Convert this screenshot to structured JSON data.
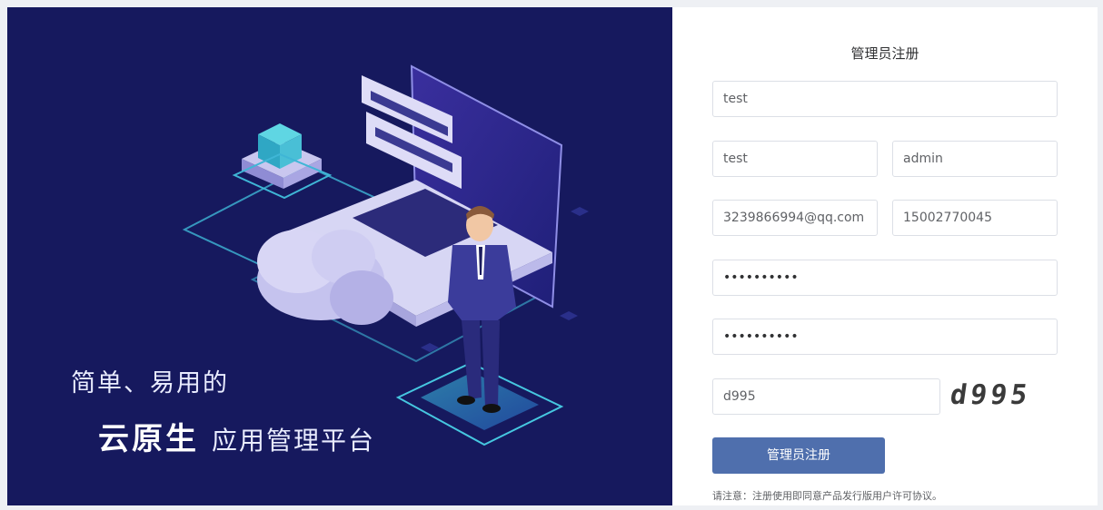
{
  "hero": {
    "slogan_line1": "简单、易用的",
    "slogan_brand": "云原生",
    "slogan_rest": "应用管理平台"
  },
  "form": {
    "title": "管理员注册",
    "fields": {
      "username": "test",
      "name": "test",
      "role": "admin",
      "email": "3239866994@qq.com",
      "phone": "15002770045",
      "password": "••••••••••",
      "confirm_password": "••••••••••",
      "captcha_input": "d995"
    },
    "captcha_image_text": "d995",
    "submit_label": "管理员注册",
    "notice": "请注意：注册使用即同意产品发行版用户许可协议。"
  },
  "colors": {
    "hero_bg": "#16195e",
    "button": "#4f6fad",
    "input_border": "#dcdfe6"
  }
}
